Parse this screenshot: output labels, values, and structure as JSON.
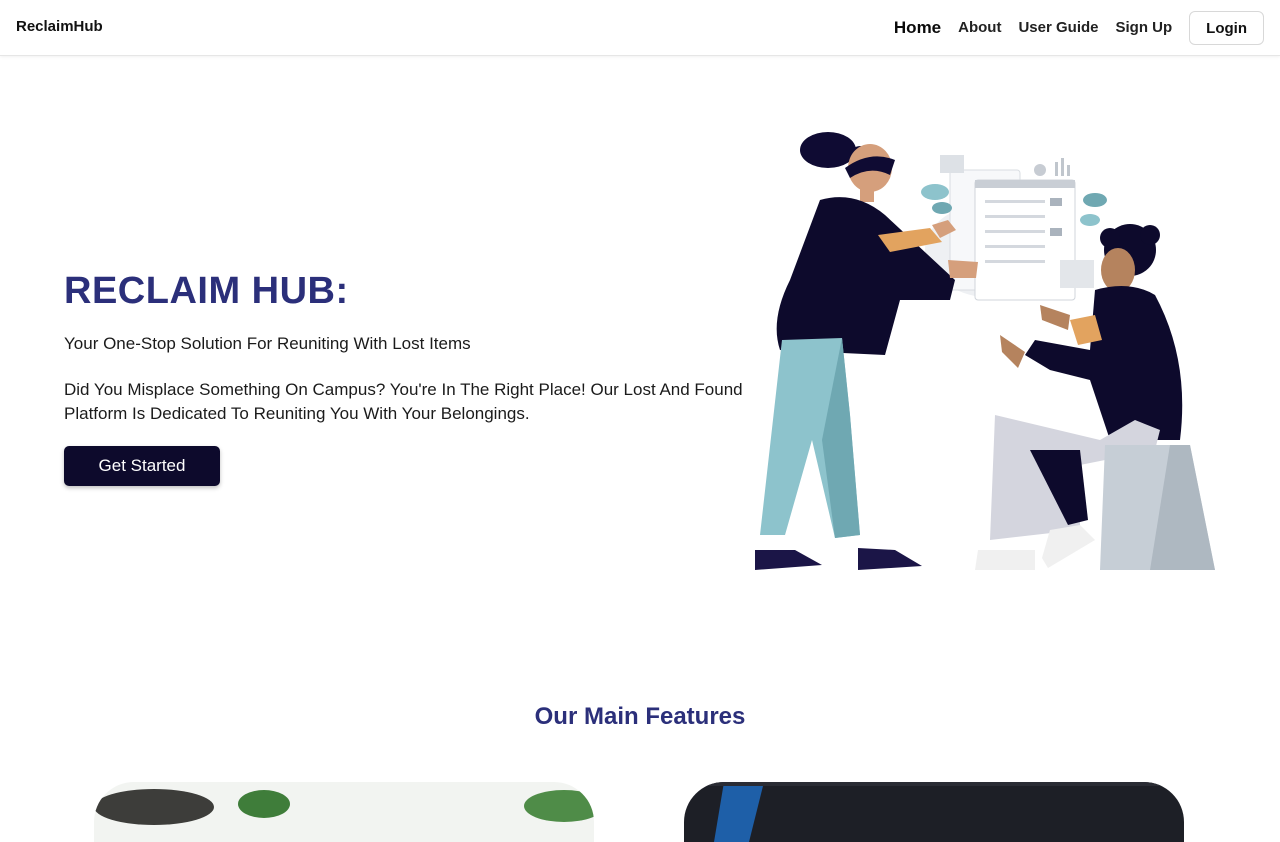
{
  "nav": {
    "brand": "ReclaimHub",
    "links": [
      "Home",
      "About",
      "User Guide",
      "Sign Up"
    ],
    "login": "Login"
  },
  "hero": {
    "title": "RECLAIM HUB:",
    "subtitle": "Your One-Stop Solution For Reuniting With Lost Items",
    "description": "Did You Misplace Something On Campus? You're In The Right Place! Our Lost And Found Platform Is Dedicated To Reuniting You With Your Belongings.",
    "cta": "Get Started"
  },
  "features": {
    "title": "Our Main Features"
  },
  "colors": {
    "accent": "#2b2f7a",
    "dark": "#0d0a2c",
    "teal": "#8dc3cc"
  }
}
